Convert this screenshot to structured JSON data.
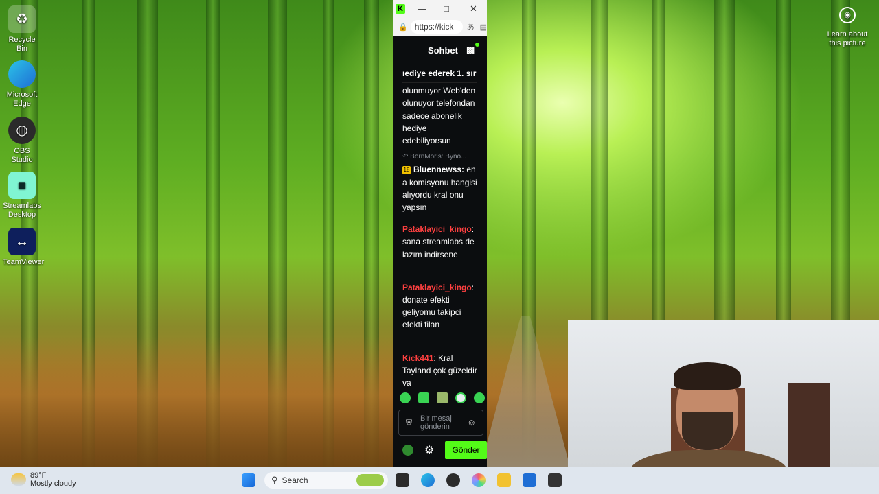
{
  "desktop": {
    "icons": [
      {
        "label": "Recycle Bin",
        "icon": "recycle-bin-icon"
      },
      {
        "label": "Microsoft Edge",
        "icon": "edge-icon"
      },
      {
        "label": "OBS Studio",
        "icon": "obs-icon"
      },
      {
        "label": "Streamlabs Desktop",
        "icon": "streamlabs-icon"
      },
      {
        "label": "TeamViewer",
        "icon": "teamviewer-icon"
      }
    ],
    "learn_about": "Learn about this picture"
  },
  "browser": {
    "address": "https://kick",
    "chat_title": "Sohbet",
    "messages": [
      {
        "user": "",
        "text": "ıediye ederek 1. sır"
      },
      {
        "user": "",
        "text": "olunmuyor Web'den olunuyor telefondan sadece abonelik hediye edebiliyorsun"
      },
      {
        "reply": "BornMoris: Byno...",
        "badge": "18",
        "user": "Bluennewss:",
        "text": "en a komisyonu hangisi alıyordu kral onu yapsın"
      },
      {
        "user": "Pataklayici_kingo",
        "text": ": sana streamlabs de lazım indirsene"
      },
      {
        "user": "Pataklayici_kingo",
        "text": ": donate efekti geliyomu takipci efekti filan"
      },
      {
        "user": "Kick441",
        "text": ": Kral Tayland çok güzeldir ya"
      }
    ],
    "input_placeholder": "Bir mesaj gönderin",
    "send_label": "Gönder",
    "accent": "#53fc18",
    "username_color": "#ff4040"
  },
  "taskbar": {
    "temperature": "89°F",
    "condition": "Mostly cloudy",
    "search_label": "Search"
  }
}
